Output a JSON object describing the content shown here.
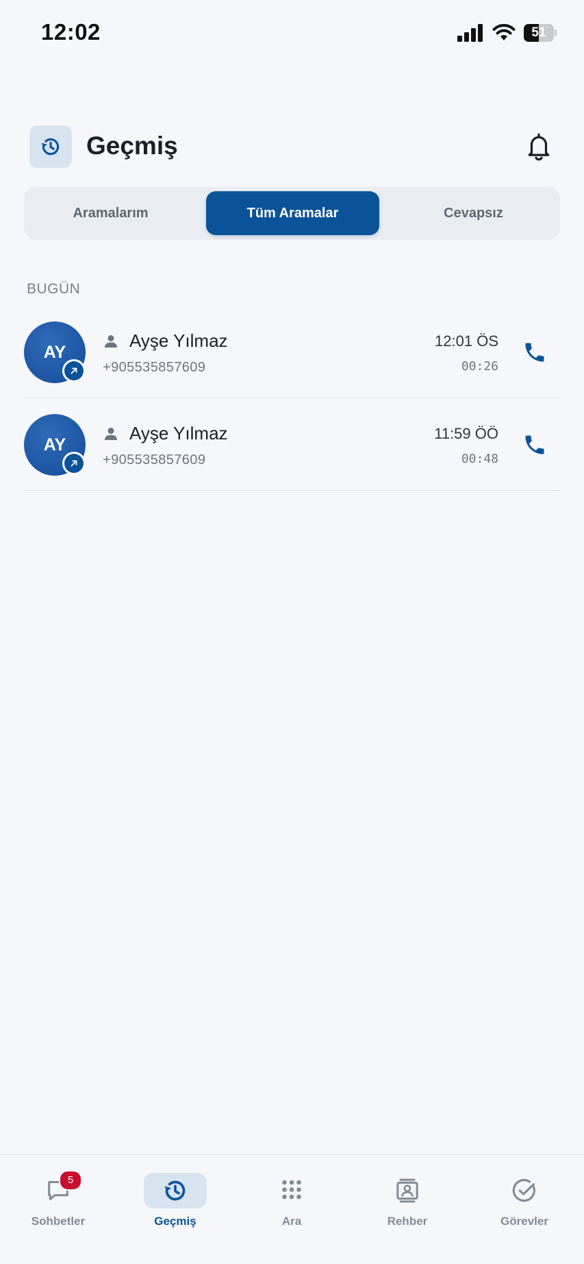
{
  "status_bar": {
    "time": "12:02",
    "battery_level": "51",
    "battery_fraction": 0.51
  },
  "header": {
    "title": "Geçmiş",
    "icon": "history-icon",
    "action_icon": "bell-icon"
  },
  "tabs": [
    {
      "label": "Aramalarım",
      "active": false
    },
    {
      "label": "Tüm Aramalar",
      "active": true
    },
    {
      "label": "Cevapsız",
      "active": false
    }
  ],
  "section": {
    "label": "BUGÜN"
  },
  "calls": [
    {
      "initials": "AY",
      "name": "Ayşe Yılmaz",
      "number": "+905535857609",
      "time": "12:01 ÖS",
      "duration": "00:26",
      "direction_icon": "outgoing-arrow-icon"
    },
    {
      "initials": "AY",
      "name": "Ayşe Yılmaz",
      "number": "+905535857609",
      "time": "11:59 ÖÖ",
      "duration": "00:48",
      "direction_icon": "outgoing-arrow-icon"
    }
  ],
  "bottom_nav": {
    "items": [
      {
        "label": "Sohbetler",
        "icon": "chat-bubble-icon",
        "badge": "5",
        "active": false
      },
      {
        "label": "Geçmiş",
        "icon": "history-icon",
        "active": true
      },
      {
        "label": "Ara",
        "icon": "dialpad-icon",
        "active": false
      },
      {
        "label": "Rehber",
        "icon": "contacts-book-icon",
        "active": false
      },
      {
        "label": "Görevler",
        "icon": "check-circle-icon",
        "active": false
      }
    ]
  },
  "colors": {
    "accent": "#0b5399",
    "avatar": "#1c55a3",
    "badge": "#c8102e",
    "background": "#f5f7fa"
  }
}
